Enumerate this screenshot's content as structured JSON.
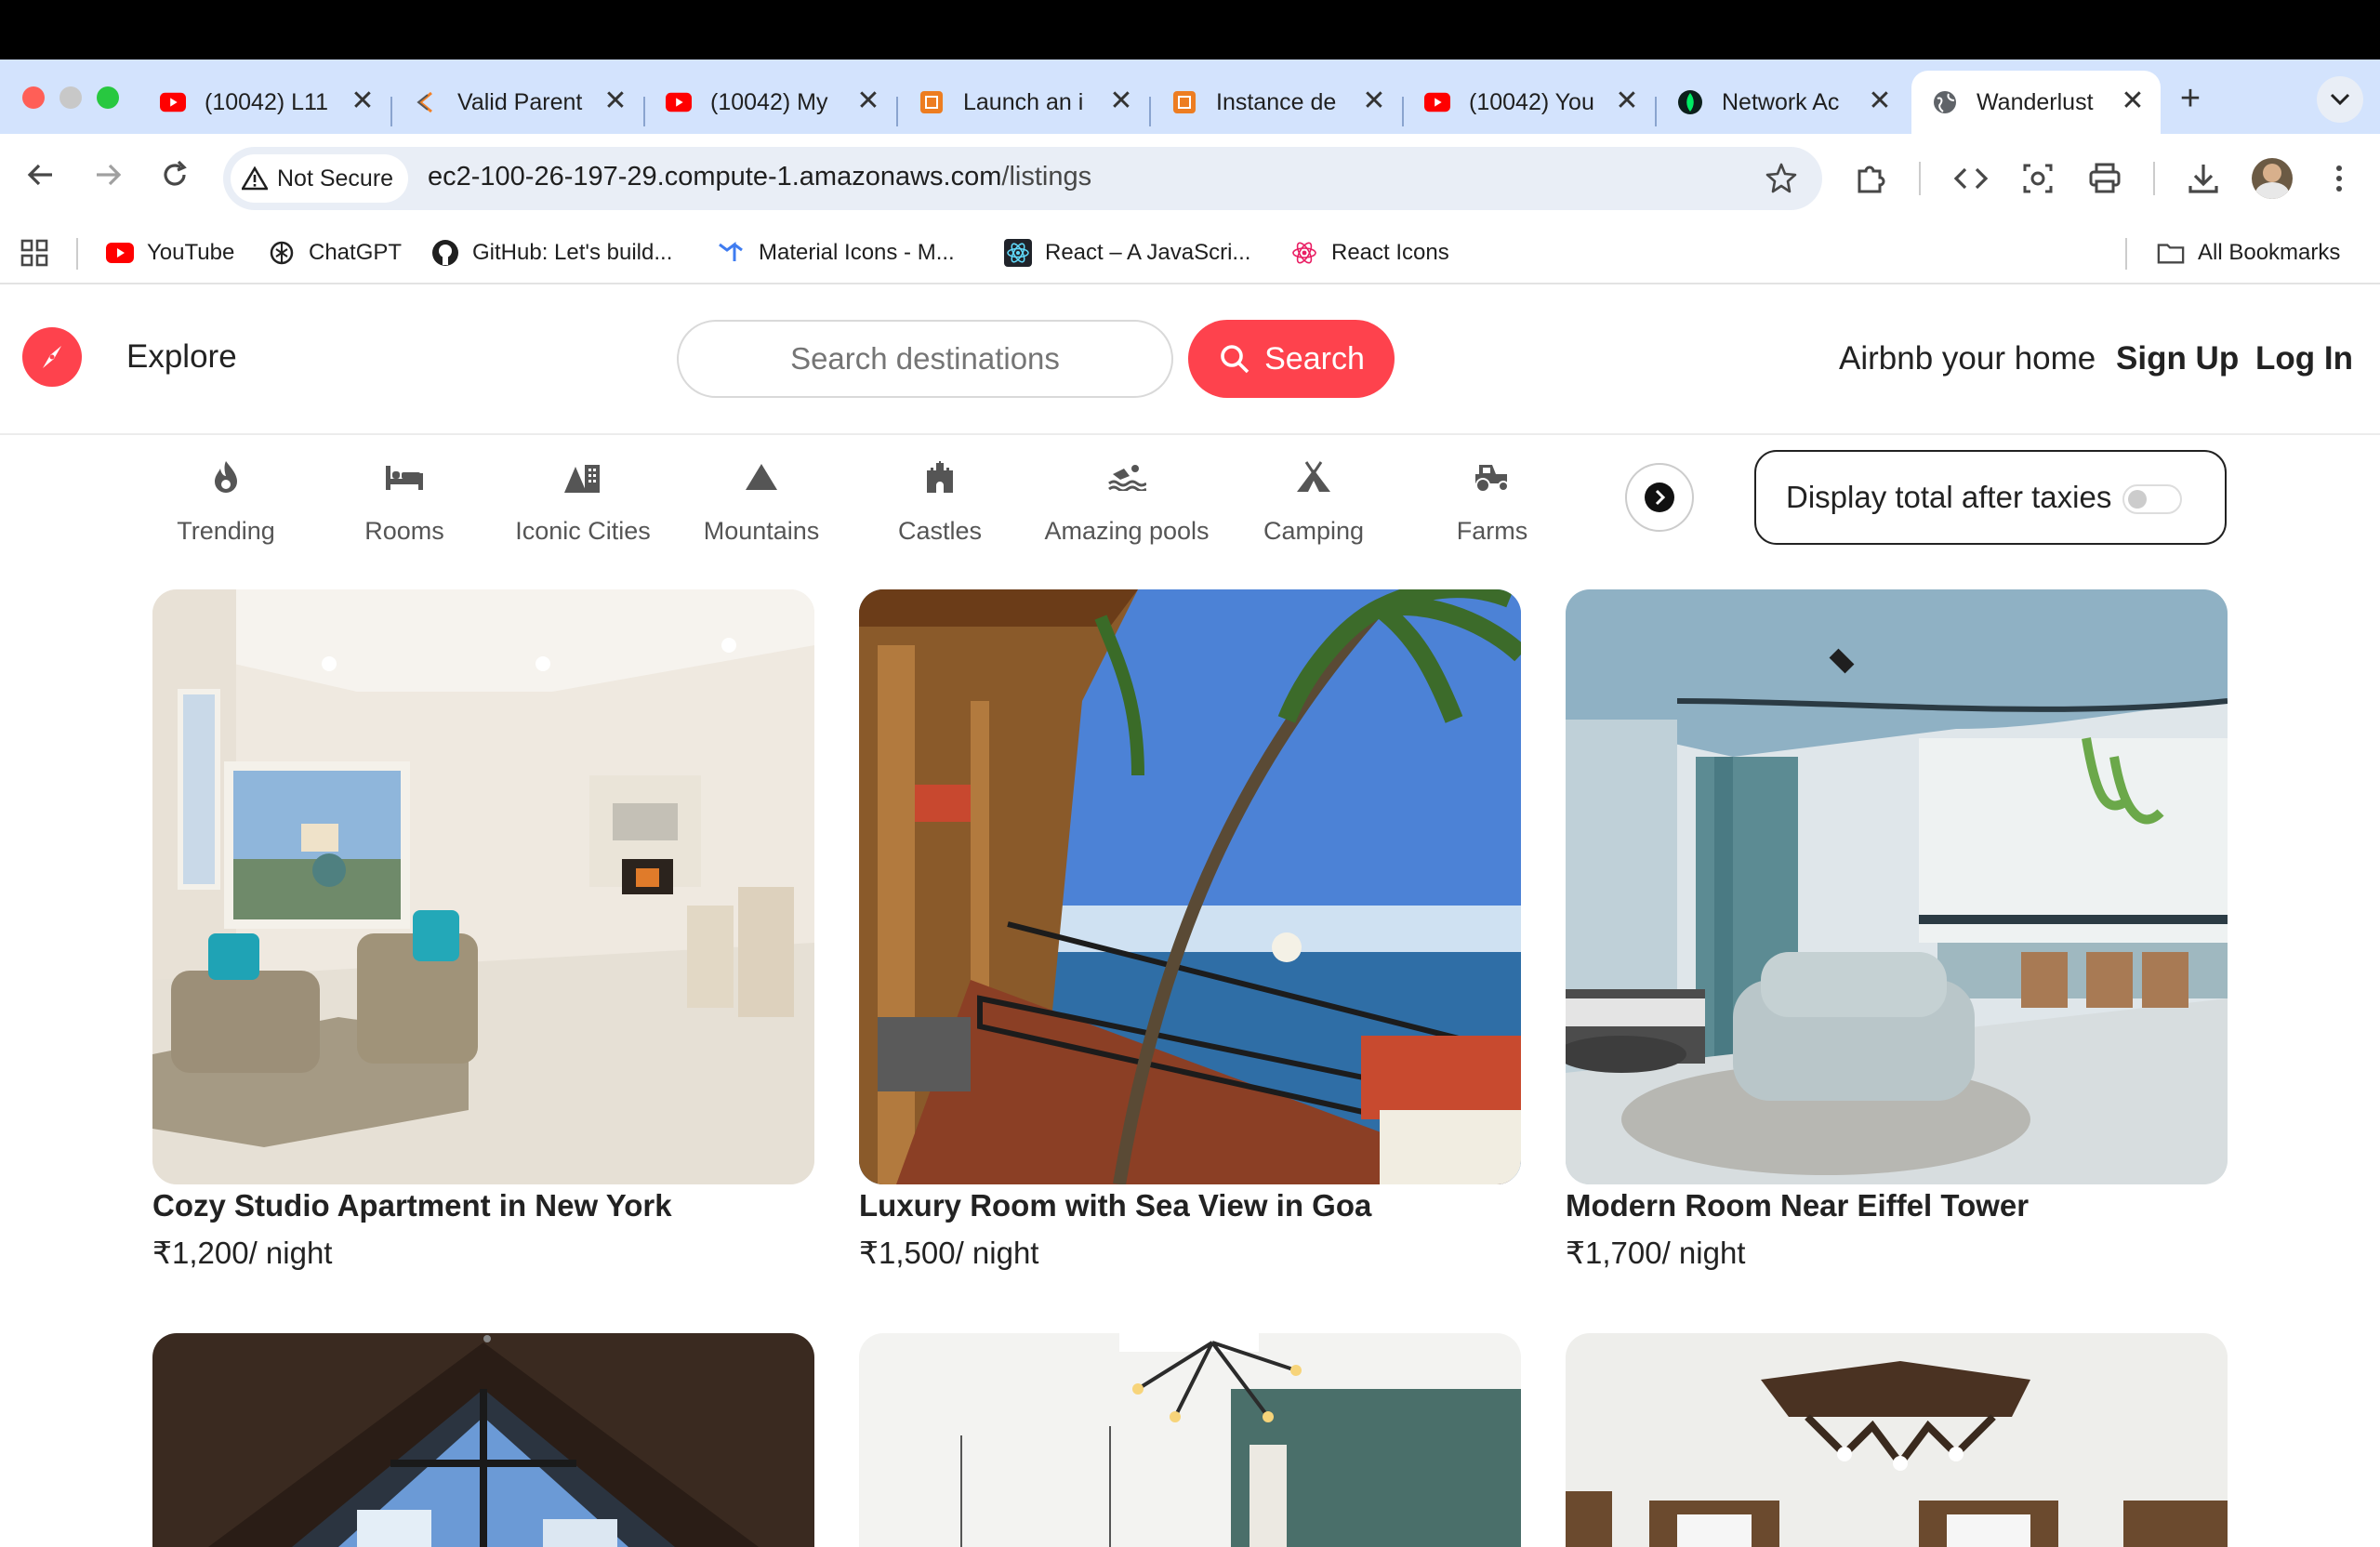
{
  "browser": {
    "tabs": [
      {
        "title": "(10042) L11",
        "icon": "youtube-icon"
      },
      {
        "title": "Valid Parent",
        "icon": "stack-icon"
      },
      {
        "title": "(10042) My",
        "icon": "youtube-icon"
      },
      {
        "title": "Launch an i",
        "icon": "aws-icon"
      },
      {
        "title": "Instance de",
        "icon": "aws-icon"
      },
      {
        "title": "(10042) You",
        "icon": "youtube-icon"
      },
      {
        "title": "Network Ac",
        "icon": "mongodb-icon"
      },
      {
        "title": "Wanderlust",
        "icon": "globe-icon",
        "active": true
      }
    ],
    "new_tab": "+",
    "close_glyph": "✕",
    "security_label": "Not Secure",
    "url_host": "ec2-100-26-197-29.compute-1.amazonaws.com",
    "url_path": "/listings",
    "bookmarks": [
      {
        "label": "YouTube",
        "icon": "youtube-icon"
      },
      {
        "label": "ChatGPT",
        "icon": "chatgpt-icon"
      },
      {
        "label": "GitHub: Let's build...",
        "icon": "github-icon"
      },
      {
        "label": "Material Icons - M...",
        "icon": "material-icon"
      },
      {
        "label": "React – A JavaScri...",
        "icon": "react-icon"
      },
      {
        "label": "React Icons",
        "icon": "react-icons-icon"
      }
    ],
    "all_bookmarks": "All Bookmarks"
  },
  "site": {
    "brand_color": "#fe424d",
    "explore": "Explore",
    "search_placeholder": "Search destinations",
    "search_button": "Search",
    "airbnb_your_home": "Airbnb your home",
    "sign_up": "Sign Up",
    "log_in": "Log In"
  },
  "filters": [
    {
      "label": "Trending",
      "icon": "fire-icon"
    },
    {
      "label": "Rooms",
      "icon": "bed-icon"
    },
    {
      "label": "Iconic Cities",
      "icon": "city-icon"
    },
    {
      "label": "Mountains",
      "icon": "mountain-icon"
    },
    {
      "label": "Castles",
      "icon": "castle-icon"
    },
    {
      "label": "Amazing pools",
      "icon": "pool-icon"
    },
    {
      "label": "Camping",
      "icon": "campground-icon"
    },
    {
      "label": "Farms",
      "icon": "tractor-icon"
    }
  ],
  "tax_toggle": {
    "label": "Display total after taxies",
    "on": false
  },
  "listings": [
    {
      "title": "Cozy Studio Apartment in New York",
      "price": "₹1,200/ night"
    },
    {
      "title": "Luxury Room with Sea View in Goa",
      "price": "₹1,500/ night"
    },
    {
      "title": "Modern Room Near Eiffel Tower",
      "price": "₹1,700/ night"
    },
    {
      "title": "",
      "price": ""
    },
    {
      "title": "",
      "price": ""
    },
    {
      "title": "",
      "price": ""
    }
  ]
}
